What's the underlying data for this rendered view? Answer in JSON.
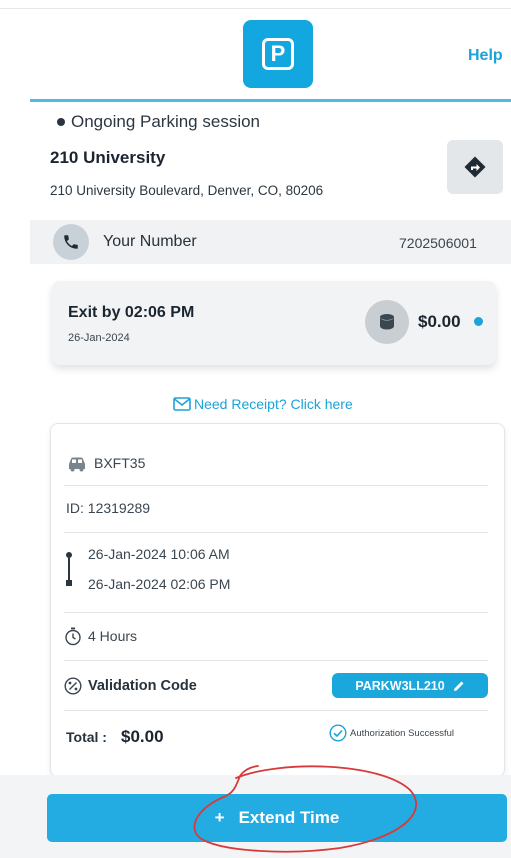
{
  "header": {
    "logo_letter": "P",
    "help_label": "Help"
  },
  "session": {
    "status": "Ongoing Parking session",
    "location_name": "210 University",
    "location_address": "210 University Boulevard, Denver, CO, 80206"
  },
  "contact": {
    "label": "Your Number",
    "value": "7202506001"
  },
  "exit": {
    "label": "Exit by 02:06 PM",
    "date": "26-Jan-2024",
    "amount": "$0.00"
  },
  "receipt": {
    "label": "Need Receipt? Click here"
  },
  "details": {
    "plate": "BXFT35",
    "id": "ID: 12319289",
    "start": "26-Jan-2024 10:06 AM",
    "end": "26-Jan-2024 02:06 PM",
    "duration": "4 Hours",
    "validation_label": "Validation Code",
    "validation_code": "PARKW3LL210",
    "total_label": "Total :",
    "total_value": "$0.00",
    "auth_status": "Authorization Successful"
  },
  "actions": {
    "extend_label": "Extend Time",
    "extend_prefix": "+"
  },
  "colors": {
    "accent": "#1aa7dc",
    "annotation": "#d83a3a"
  }
}
